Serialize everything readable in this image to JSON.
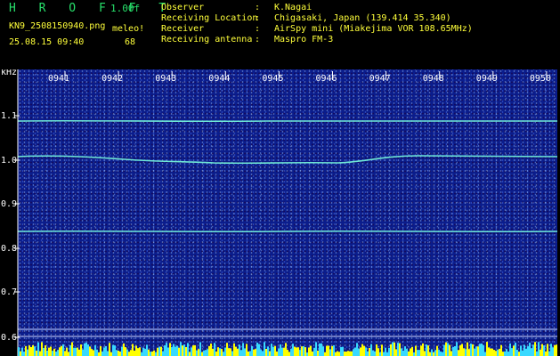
{
  "header": {
    "brand": "H R O F F T",
    "version": "1.00f",
    "filename": "KN9_2508150940.png",
    "datetime": "25.08.15 09:40",
    "meleo_label": "meleo!",
    "meleo_value": "68",
    "info": [
      {
        "label": "Observer",
        "value": "K.Nagai"
      },
      {
        "label": "Receiving Location",
        "value": "Chigasaki, Japan (139.414 35.340)"
      },
      {
        "label": "Receiver",
        "value": "AirSpy mini (Miakejima VOR 108.65MHz)"
      },
      {
        "label": "Receiving antenna",
        "value": "Maspro FM-3"
      }
    ]
  },
  "axis": {
    "unit": "kHz",
    "y_ticks": [
      "1.1",
      "1.0",
      "0.9",
      "0.8",
      "0.7",
      "0.6"
    ],
    "time_ticks": [
      "0941",
      "0942",
      "0943",
      "0944",
      "0945",
      "0946",
      "0947",
      "0948",
      "0949",
      "0950"
    ]
  },
  "colors": {
    "background": "#000000",
    "spectrogram": "#0b1d8c",
    "trace": "#6fe8d6",
    "header_text": "#ffff3a",
    "brand": "#27e06b",
    "baseline": "#ffff00"
  }
}
